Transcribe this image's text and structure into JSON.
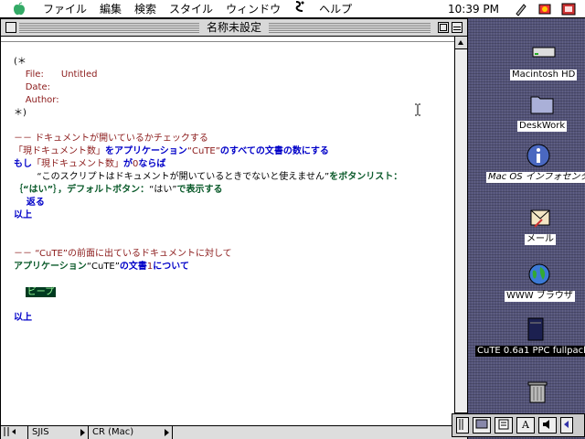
{
  "menubar": {
    "apple_icon": "apple-menu-icon",
    "items": [
      "ファイル",
      "編集",
      "検索",
      "スタイル",
      "ウィンドウ",
      "ヘルプ"
    ],
    "script_icon": "script-menu-icon",
    "clock": "10:39 PM"
  },
  "window": {
    "title": "名称未設定"
  },
  "script": {
    "lines": [
      {
        "parts": [
          {
            "t": "(＊",
            "c": "k"
          }
        ]
      },
      {
        "parts": [
          {
            "t": "    File:      Untitled",
            "c": "r"
          }
        ]
      },
      {
        "parts": [
          {
            "t": "    Date:",
            "c": "r"
          }
        ]
      },
      {
        "parts": [
          {
            "t": "    Author:",
            "c": "r"
          }
        ]
      },
      {
        "parts": [
          {
            "t": "＊)",
            "c": "k"
          }
        ]
      },
      {
        "parts": []
      },
      {
        "parts": [
          {
            "t": "－－ ドキュメントが開いているかチェックする",
            "c": "r"
          }
        ]
      },
      {
        "parts": [
          {
            "t": "「現ドキュメント数」",
            "c": "r"
          },
          {
            "t": "をアプリケーション",
            "c": "b"
          },
          {
            "t": "“CuTE”",
            "c": "r"
          },
          {
            "t": "のすべての文書の数にする",
            "c": "b"
          }
        ]
      },
      {
        "parts": [
          {
            "t": "もし",
            "c": "b"
          },
          {
            "t": "「現ドキュメント数」",
            "c": "r"
          },
          {
            "t": "が",
            "c": "b"
          },
          {
            "t": "0",
            "c": "r"
          },
          {
            "t": "ならば",
            "c": "b"
          }
        ]
      },
      {
        "parts": [
          {
            "t": "        “このスクリプトはドキュメントが開いているときでないと使えません”",
            "c": "k"
          },
          {
            "t": "をボタンリスト：",
            "c": "g"
          }
        ]
      },
      {
        "parts": [
          {
            "t": "｛“はい”｝，デフォルトボタン：",
            "c": "g"
          },
          {
            "t": "“はい”",
            "c": "k"
          },
          {
            "t": "で表示する",
            "c": "g"
          }
        ]
      },
      {
        "parts": [
          {
            "t": "    返る",
            "c": "b"
          }
        ]
      },
      {
        "parts": [
          {
            "t": "以上",
            "c": "b"
          }
        ]
      },
      {
        "parts": []
      },
      {
        "parts": []
      },
      {
        "parts": [
          {
            "t": "－－ ",
            "c": "r"
          },
          {
            "t": "“CuTE”",
            "c": "r"
          },
          {
            "t": "の前面に出ているドキュメントに対して",
            "c": "r"
          }
        ]
      },
      {
        "parts": [
          {
            "t": "アプリケーション",
            "c": "g"
          },
          {
            "t": "“CuTE”",
            "c": "k"
          },
          {
            "t": "の文書",
            "c": "b"
          },
          {
            "t": "1",
            "c": "r"
          },
          {
            "t": "について",
            "c": "b"
          }
        ]
      },
      {
        "parts": []
      },
      {
        "parts": [
          {
            "t": "    ",
            "c": "k"
          },
          {
            "t": "ビープ",
            "c": "hl"
          }
        ]
      },
      {
        "parts": []
      },
      {
        "parts": [
          {
            "t": "以上",
            "c": "b"
          }
        ]
      }
    ]
  },
  "statusbar": {
    "encoding": "SJIS",
    "line_ending": "CR (Mac)"
  },
  "desktop_icons": [
    {
      "name": "macintosh-hd",
      "label": "Macintosh HD",
      "icon": "hard-disk-icon"
    },
    {
      "name": "deskwork",
      "label": "DeskWork",
      "icon": "folder-icon"
    },
    {
      "name": "mac-os-info",
      "label": "Mac OS インフォセンタ",
      "icon": "info-icon"
    },
    {
      "name": "mail",
      "label": "メール",
      "icon": "mail-icon"
    },
    {
      "name": "www-browser",
      "label": "WWW ブラウザ",
      "icon": "globe-icon"
    },
    {
      "name": "cute-package",
      "label": "CuTE 0.6a1 PPC fullpacka",
      "icon": "package-icon"
    },
    {
      "name": "trash",
      "label": "",
      "icon": "trash-icon"
    }
  ],
  "control_strip": {
    "buttons": [
      "A"
    ]
  }
}
